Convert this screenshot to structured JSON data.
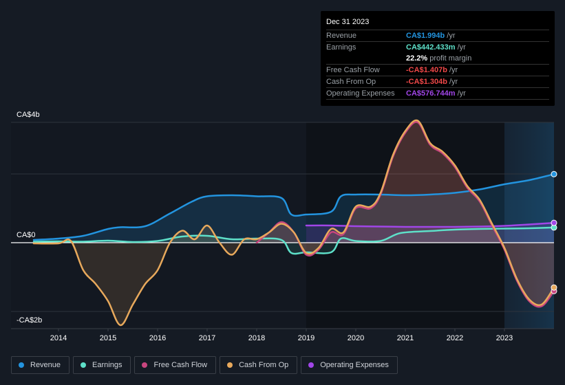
{
  "colors": {
    "revenue": "#2394df",
    "earnings": "#5ee0c9",
    "fcf": "#c8467f",
    "cfo": "#e8a95c",
    "opex": "#a146e8",
    "negative": "#f04848"
  },
  "tooltip": {
    "date": "Dec 31 2023",
    "rows": [
      {
        "label": "Revenue",
        "value": "CA$1.994b",
        "suffix": "/yr",
        "color_key": "revenue"
      },
      {
        "label": "Earnings",
        "value": "CA$442.433m",
        "suffix": "/yr",
        "color_key": "earnings"
      },
      {
        "label": "",
        "value": "22.2%",
        "suffix": "profit margin",
        "color_key": "white"
      },
      {
        "label": "Free Cash Flow",
        "value": "-CA$1.407b",
        "suffix": "/yr",
        "color_key": "negative"
      },
      {
        "label": "Cash From Op",
        "value": "-CA$1.304b",
        "suffix": "/yr",
        "color_key": "negative"
      },
      {
        "label": "Operating Expenses",
        "value": "CA$576.744m",
        "suffix": "/yr",
        "color_key": "opex"
      }
    ]
  },
  "legend": [
    {
      "label": "Revenue",
      "color_key": "revenue"
    },
    {
      "label": "Earnings",
      "color_key": "earnings"
    },
    {
      "label": "Free Cash Flow",
      "color_key": "fcf"
    },
    {
      "label": "Cash From Op",
      "color_key": "cfo"
    },
    {
      "label": "Operating Expenses",
      "color_key": "opex"
    }
  ],
  "chart_data": {
    "type": "area",
    "title": "",
    "xlabel": "",
    "ylabel": "",
    "y_unit": "CA$ billions",
    "y_ticks": [
      {
        "value": 3.5,
        "label": "CA$4b"
      },
      {
        "value": 0,
        "label": "CA$0"
      },
      {
        "value": -2,
        "label": "-CA$2b"
      }
    ],
    "y_gridlines": [
      3.5,
      2,
      0,
      -2
    ],
    "ylim": [
      -2.5,
      3.5
    ],
    "xlim": [
      2013.0,
      2024.0
    ],
    "x_ticks": [
      2014,
      2015,
      2016,
      2017,
      2018,
      2019,
      2020,
      2021,
      2022,
      2023
    ],
    "highlight_from": 2023.0,
    "legend_position": "bottom-left",
    "series": [
      {
        "name": "Revenue",
        "color_key": "revenue",
        "fill": true,
        "x": [
          2013.5,
          2014.0,
          2014.5,
          2015.0,
          2015.25,
          2015.75,
          2016.25,
          2016.7,
          2017.0,
          2017.5,
          2018.0,
          2018.5,
          2018.7,
          2019.0,
          2019.5,
          2019.7,
          2020.0,
          2020.5,
          2021.0,
          2021.5,
          2022.0,
          2022.5,
          2023.0,
          2023.5,
          2024.0
        ],
        "y": [
          0.08,
          0.12,
          0.2,
          0.4,
          0.45,
          0.48,
          0.85,
          1.2,
          1.35,
          1.38,
          1.35,
          1.3,
          0.82,
          0.82,
          0.9,
          1.35,
          1.4,
          1.4,
          1.38,
          1.4,
          1.45,
          1.55,
          1.7,
          1.82,
          1.994
        ]
      },
      {
        "name": "Earnings",
        "color_key": "earnings",
        "fill": true,
        "x": [
          2013.5,
          2014.0,
          2014.5,
          2015.0,
          2015.5,
          2016.0,
          2016.5,
          2017.0,
          2017.5,
          2018.0,
          2018.5,
          2018.7,
          2019.0,
          2019.5,
          2019.7,
          2020.0,
          2020.5,
          2020.9,
          2021.5,
          2022.0,
          2022.5,
          2023.0,
          2023.5,
          2024.0
        ],
        "y": [
          0.03,
          0.04,
          0.03,
          0.06,
          0.02,
          0.05,
          0.18,
          0.2,
          0.1,
          0.12,
          0.08,
          -0.3,
          -0.28,
          -0.28,
          0.12,
          0.05,
          0.05,
          0.28,
          0.34,
          0.38,
          0.4,
          0.41,
          0.42,
          0.442
        ]
      },
      {
        "name": "Free Cash Flow",
        "color_key": "fcf",
        "fill": true,
        "x": [
          2018.0,
          2018.25,
          2018.5,
          2018.75,
          2019.0,
          2019.25,
          2019.5,
          2019.75,
          2020.0,
          2020.3,
          2020.5,
          2020.75,
          2021.0,
          2021.25,
          2021.5,
          2021.75,
          2022.0,
          2022.25,
          2022.5,
          2022.75,
          2023.0,
          2023.25,
          2023.5,
          2023.75,
          2024.0
        ],
        "y": [
          0.0,
          0.3,
          0.6,
          0.3,
          -0.35,
          -0.2,
          0.3,
          0.25,
          1.0,
          1.0,
          1.4,
          2.5,
          3.2,
          3.5,
          2.85,
          2.6,
          2.2,
          1.6,
          1.2,
          0.5,
          -0.2,
          -1.1,
          -1.7,
          -1.85,
          -1.407
        ]
      },
      {
        "name": "Cash From Op",
        "color_key": "cfo",
        "fill": true,
        "x": [
          2013.5,
          2014.0,
          2014.25,
          2014.5,
          2014.75,
          2015.0,
          2015.25,
          2015.5,
          2015.75,
          2016.0,
          2016.25,
          2016.5,
          2016.75,
          2017.0,
          2017.25,
          2017.5,
          2017.75,
          2018.0,
          2018.25,
          2018.5,
          2018.75,
          2019.0,
          2019.25,
          2019.5,
          2019.75,
          2020.0,
          2020.3,
          2020.5,
          2020.75,
          2021.0,
          2021.25,
          2021.5,
          2021.75,
          2022.0,
          2022.25,
          2022.5,
          2022.75,
          2023.0,
          2023.25,
          2023.5,
          2023.75,
          2024.0
        ],
        "y": [
          -0.02,
          -0.02,
          0.05,
          -0.8,
          -1.2,
          -1.7,
          -2.4,
          -1.8,
          -1.2,
          -0.8,
          0.0,
          0.35,
          0.1,
          0.5,
          0.0,
          -0.35,
          0.1,
          0.1,
          0.3,
          0.55,
          0.3,
          -0.3,
          -0.15,
          0.4,
          0.3,
          1.05,
          1.05,
          1.45,
          2.55,
          3.25,
          3.55,
          2.9,
          2.65,
          2.25,
          1.65,
          1.25,
          0.55,
          -0.15,
          -1.05,
          -1.65,
          -1.8,
          -1.304
        ]
      },
      {
        "name": "Operating Expenses",
        "color_key": "opex",
        "fill": true,
        "x": [
          2019.0,
          2019.5,
          2020.0,
          2020.5,
          2021.0,
          2021.5,
          2022.0,
          2022.5,
          2023.0,
          2023.5,
          2024.0
        ],
        "y": [
          0.5,
          0.5,
          0.48,
          0.47,
          0.46,
          0.46,
          0.46,
          0.47,
          0.49,
          0.53,
          0.577
        ]
      }
    ]
  }
}
